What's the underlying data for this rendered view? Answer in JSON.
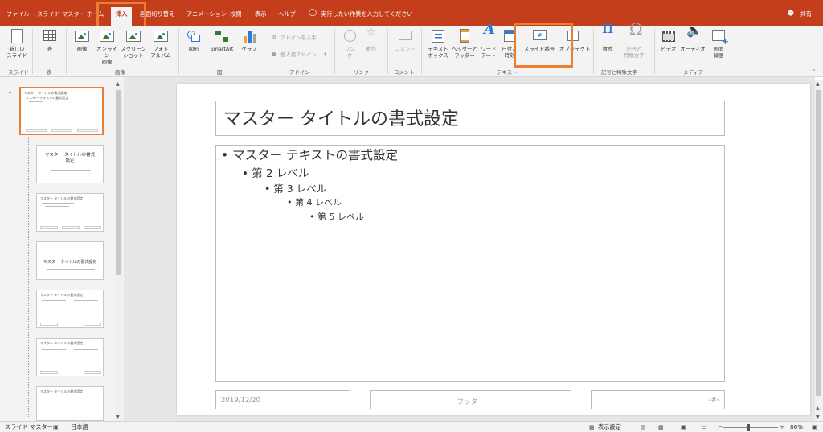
{
  "tabs": [
    {
      "label": "ファイル"
    },
    {
      "label": "スライド マスター"
    },
    {
      "label": "ホーム"
    },
    {
      "label": "挿入",
      "active": true
    },
    {
      "label": "画面切り替え"
    },
    {
      "label": "アニメーション"
    },
    {
      "label": "校閲"
    },
    {
      "label": "表示"
    },
    {
      "label": "ヘルプ"
    }
  ],
  "tell_me": "実行したい作業を入力してください",
  "share": "共有",
  "ribbon": {
    "new_slide": "新しい\nスライド",
    "table": "表",
    "image": "画像",
    "online_image": "オンライン\n画像",
    "screenshot": "スクリーン\nショット",
    "photo_album": "フォト\nアルバム",
    "shapes": "図形",
    "smartart": "SmartArt",
    "graph": "グラフ",
    "get_addins": "アドインを入手",
    "my_addins": "個人用アドイン",
    "link": "リン\nク",
    "action": "動作",
    "comment": "コメント",
    "textbox": "テキスト\nボックス",
    "header_footer": "ヘッダーと\nフッター",
    "wordart": "ワード\nアート",
    "date_time": "日付と\n時刻",
    "slide_number": "スライド番号",
    "object": "オブジェクト",
    "equation": "数式",
    "symbol": "記号と\n特殊文字",
    "video": "ビデオ",
    "audio": "オーディオ",
    "screen_recording": "画面\n録画"
  },
  "groups": {
    "slides": "スライド",
    "tables": "表",
    "images": "画像",
    "illustrations": "図",
    "addins": "アドイン",
    "links": "リンク",
    "comments": "コメント",
    "text": "テキスト",
    "symbols": "記号と特殊文字",
    "media": "メディア"
  },
  "thumbnails": {
    "slide_number": "1",
    "master_title": "マスター タイトルの書式設定",
    "master_text": "マスター テキストの書式設定"
  },
  "slide": {
    "title": "マスター タイトルの書式設定",
    "levels": [
      "マスター テキストの書式設定",
      "第 2 レベル",
      "第 3 レベル",
      "第 4 レベル",
      "第 5 レベル"
    ],
    "date": "2019/12/20",
    "footer": "フッター",
    "slide_number": "‹#›"
  },
  "status": {
    "view": "スライド マスター",
    "language": "日本語",
    "display_settings": "表示設定",
    "zoom": "86%"
  },
  "colors": {
    "accent": "#c43e1c",
    "highlight": "#ed7d31"
  }
}
